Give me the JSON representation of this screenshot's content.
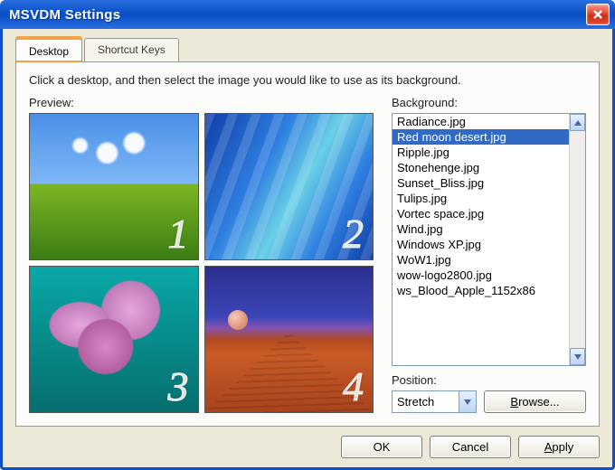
{
  "window": {
    "title": "MSVDM Settings"
  },
  "tabs": {
    "desktop": "Desktop",
    "shortcut": "Shortcut Keys"
  },
  "instructions": "Click a desktop, and then select the image you would like to use as its background.",
  "labels": {
    "preview": "Preview:",
    "background": "Background:",
    "position": "Position:"
  },
  "backgrounds": {
    "items": [
      "Radiance.jpg",
      "Red moon desert.jpg",
      "Ripple.jpg",
      "Stonehenge.jpg",
      "Sunset_Bliss.jpg",
      "Tulips.jpg",
      "Vortec space.jpg",
      "Wind.jpg",
      "Windows XP.jpg",
      "WoW1.jpg",
      "wow-logo2800.jpg",
      "ws_Blood_Apple_1152x86"
    ],
    "selected_index": 1
  },
  "position": {
    "value": "Stretch"
  },
  "buttons": {
    "browse": "Browse...",
    "ok": "OK",
    "cancel": "Cancel",
    "apply": "Apply"
  },
  "thumbs": {
    "n1": "1",
    "n2": "2",
    "n3": "3",
    "n4": "4"
  }
}
